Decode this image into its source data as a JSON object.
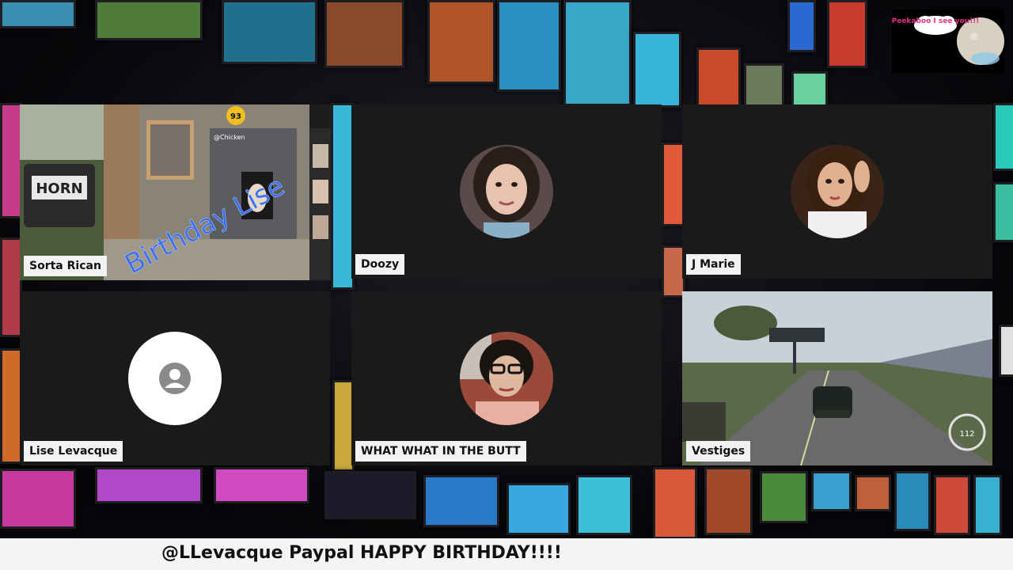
{
  "participants": [
    {
      "name": "Sorta Rican",
      "type": "video",
      "overlay_text": "Birthday Lise",
      "chat_handle": "@Chicken",
      "badge": "93",
      "sign_text": "HORN"
    },
    {
      "name": "Doozy",
      "type": "avatar"
    },
    {
      "name": "J Marie",
      "type": "avatar"
    },
    {
      "name": "Lise Levacque",
      "type": "default-avatar"
    },
    {
      "name": "WHAT WHAT IN THE BUTT",
      "type": "avatar"
    },
    {
      "name": "Vestiges",
      "type": "video",
      "speed": "112"
    }
  ],
  "overlay": {
    "peekaboo_text": "Peekaboo I see you!!!"
  },
  "ticker": {
    "text": "@LLevacque Paypal HAPPY BIRTHDAY!!!!"
  },
  "colors": {
    "tile_bg": "#1a1a1a",
    "tag_bg": "#f2f2f2",
    "bar_bg": "#f4f4f2"
  }
}
